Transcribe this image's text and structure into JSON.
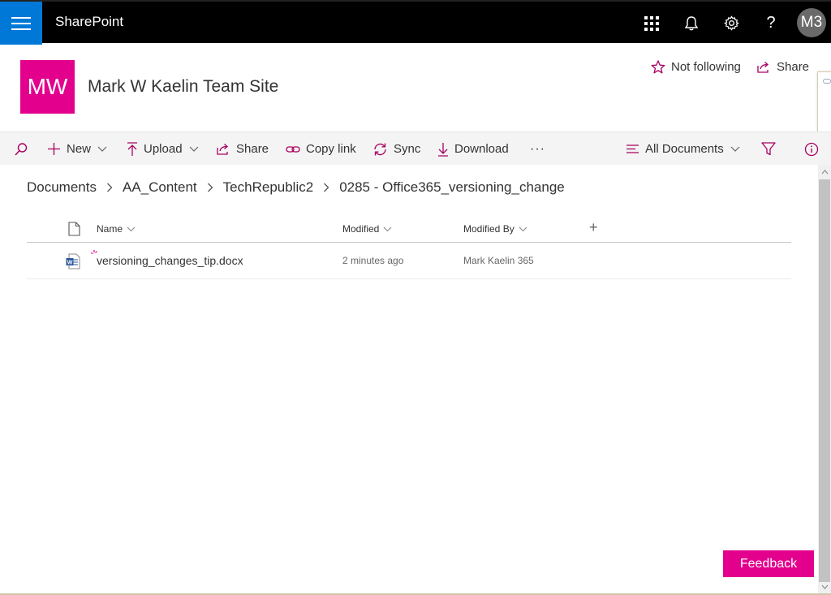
{
  "suite_bar": {
    "app_name": "SharePoint",
    "avatar_initials": "M3",
    "icons": [
      "waffle-icon",
      "app-launcher-icon",
      "bell-icon",
      "gear-icon",
      "help-icon"
    ]
  },
  "site": {
    "logo_text": "MW",
    "title": "Mark W Kaelin Team Site",
    "follow_label": "Not following",
    "share_label": "Share",
    "accent_color": "#e3008c"
  },
  "command_bar": {
    "new_label": "New",
    "upload_label": "Upload",
    "share_label": "Share",
    "copy_link_label": "Copy link",
    "sync_label": "Sync",
    "download_label": "Download",
    "more_label": "···",
    "view_label": "All Documents"
  },
  "breadcrumb": [
    "Documents",
    "AA_Content",
    "TechRepublic2",
    "0285 - Office365_versioning_change"
  ],
  "list": {
    "columns": {
      "name": "Name",
      "modified": "Modified",
      "modified_by": "Modified By",
      "add": "+"
    },
    "rows": [
      {
        "name": "versioning_changes_tip.docx",
        "modified": "2 minutes ago",
        "modified_by": "Mark Kaelin 365",
        "file_type_icon": "word-doc-icon",
        "new_indicator": "new-item-icon"
      }
    ]
  },
  "feedback_label": "Feedback"
}
